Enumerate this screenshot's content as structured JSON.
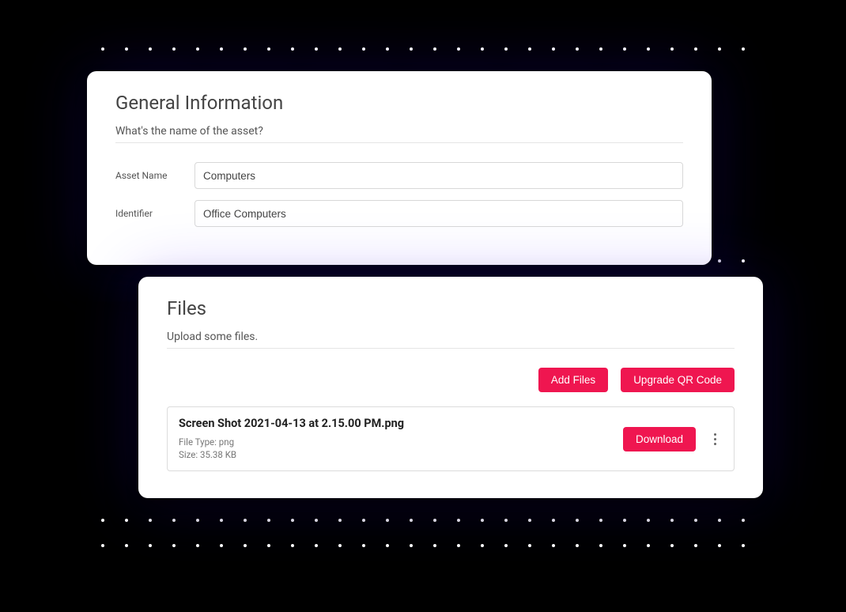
{
  "general": {
    "title": "General Information",
    "subtitle": "What's the name of the asset?",
    "rows": {
      "asset_name": {
        "label": "Asset Name",
        "value": "Computers"
      },
      "identifier": {
        "label": "Identifier",
        "value": "Office Computers"
      }
    }
  },
  "files": {
    "title": "Files",
    "subtitle": "Upload some files.",
    "buttons": {
      "add": "Add Files",
      "qr": "Upgrade QR Code"
    },
    "item": {
      "name": "Screen Shot 2021-04-13 at 2.15.00 PM.png",
      "type_label": "File Type: png",
      "size_label": "Size: 35.38 KB",
      "download": "Download"
    }
  }
}
